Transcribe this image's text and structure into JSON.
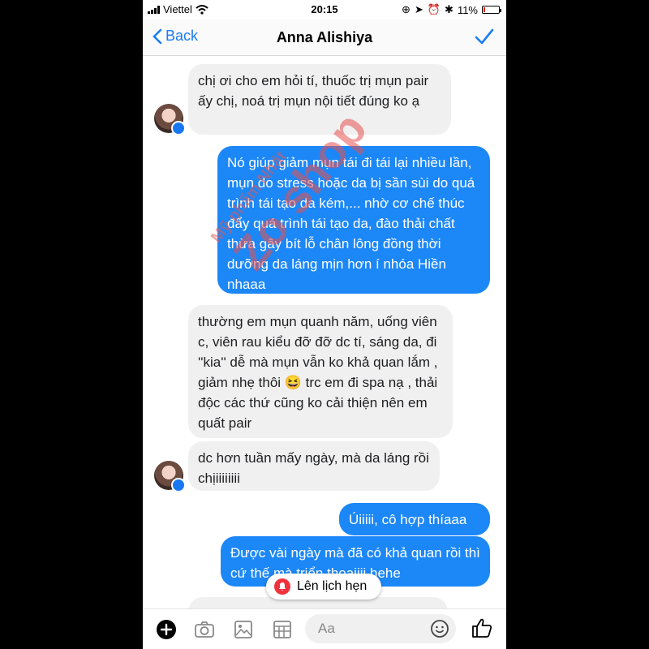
{
  "status_bar": {
    "carrier": "Viettel",
    "time": "20:15",
    "battery": "11%",
    "battery_level": 0.11
  },
  "header": {
    "back_label": "Back",
    "title": "Anna Alishiya"
  },
  "messages": [
    {
      "side": "in",
      "text": "chị ơi cho em hỏi tí, thuốc trị mụn pair ấy chị, noá trị mụn nội tiết đúng ko ạ"
    },
    {
      "side": "out",
      "text": "Nó giúp giảm mụn tái đi tái lại nhiều lần, mụn do stress hoặc da bị sần sùi do quá trình tái tạo da kém,... nhờ cơ chế thúc đẩy quá trình tái tạo da, đào thải chất thừa gây bít lỗ chân lông đồng thời dưỡng da láng mịn hơn í nhóa Hiền nhaaa"
    },
    {
      "side": "in",
      "text": "thường em mụn quanh năm, uống viên c, viên rau kiểu đỡ đỡ dc tí, sáng da, đi ''kia'' dễ mà mụn vẫn ko khả quan lắm , giảm nhẹ thôi 😆 trc em đi spa nạ , thải độc các thứ cũng ko cải thiện nên em quất pair"
    },
    {
      "side": "in",
      "text": "dc hơn tuần mấy ngày, mà da láng rồi chịiiiiiiii"
    },
    {
      "side": "out",
      "text": "Úiiiii, cô hợp thíaaa"
    },
    {
      "side": "out",
      "text": "Được vài ngày mà đã có khả quan rồi thì cứ thế mà triển thoaiiii hehe"
    }
  ],
  "watermark": {
    "line1": "Mỹ phẩm Nhật",
    "line2": "Zo shop"
  },
  "reminder": {
    "label": "Lên lịch hẹn"
  },
  "composer": {
    "placeholder": "Aa"
  },
  "colors": {
    "accent": "#1c87f7",
    "incoming_bubble": "#f1f0f0",
    "bell": "#f0323c"
  },
  "icons": [
    "signal-icon",
    "wifi-icon",
    "battery-icon",
    "back-chevron-icon",
    "checkmark-icon",
    "messenger-badge-icon",
    "bell-icon",
    "add-icon",
    "camera-icon",
    "gallery-icon",
    "grid-icon",
    "emoji-icon",
    "like-icon"
  ]
}
